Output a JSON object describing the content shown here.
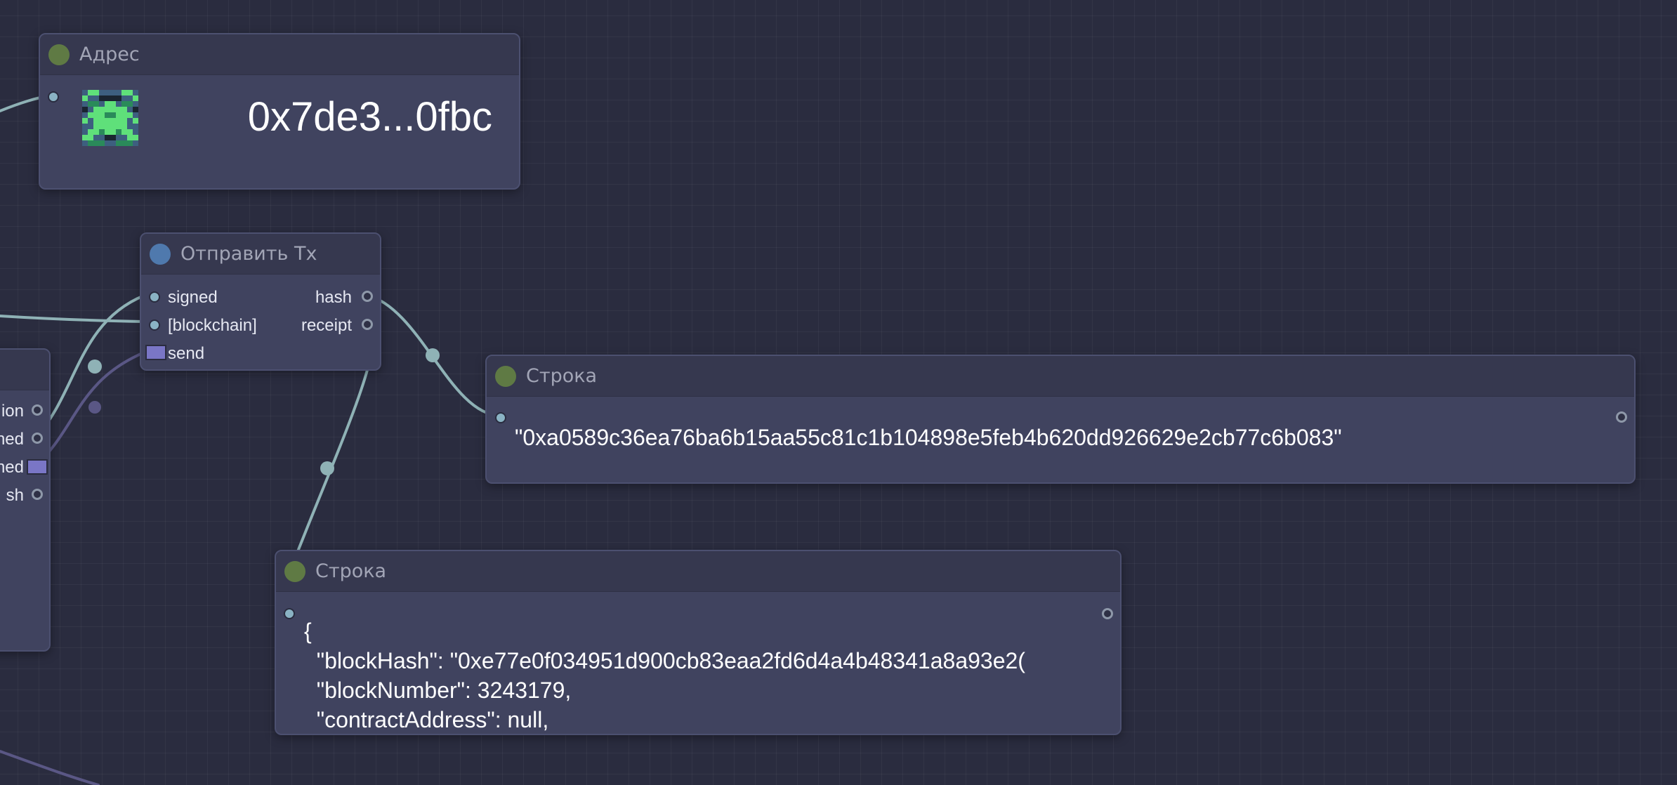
{
  "nodes": {
    "address": {
      "title": "Адрес",
      "value": "0x7de3...0fbc",
      "avatar_icon": "identicon-icon"
    },
    "send_tx": {
      "title": "Отправить Tx",
      "inputs": [
        "signed",
        "[blockchain]",
        "send"
      ],
      "outputs": [
        "hash",
        "receipt"
      ]
    },
    "string_hash": {
      "title": "Строка",
      "value": "\"0xa0589c36ea76ba6b15aa55c81c1b104898e5feb4b620dd926629e2cb77c6b083\""
    },
    "string_receipt": {
      "title": "Строка",
      "lines": [
        "{",
        "  \"blockHash\": \"0xe77e0f034951d900cb83eaa2fd6d4a4b48341a8a93e2(",
        "  \"blockNumber\": 3243179,",
        "  \"contractAddress\": null,"
      ]
    },
    "left_partial": {
      "outputs": [
        "ion",
        "ned",
        "ned",
        "sh"
      ]
    }
  },
  "colors": {
    "canvas": "#2a2c3f",
    "node_body": "#40435f",
    "node_header": "#36384f",
    "wire_data": "#8fb2b6",
    "wire_flow": "#5a5785",
    "dot_green": "#5f7a44",
    "dot_blue": "#4f79ad"
  }
}
